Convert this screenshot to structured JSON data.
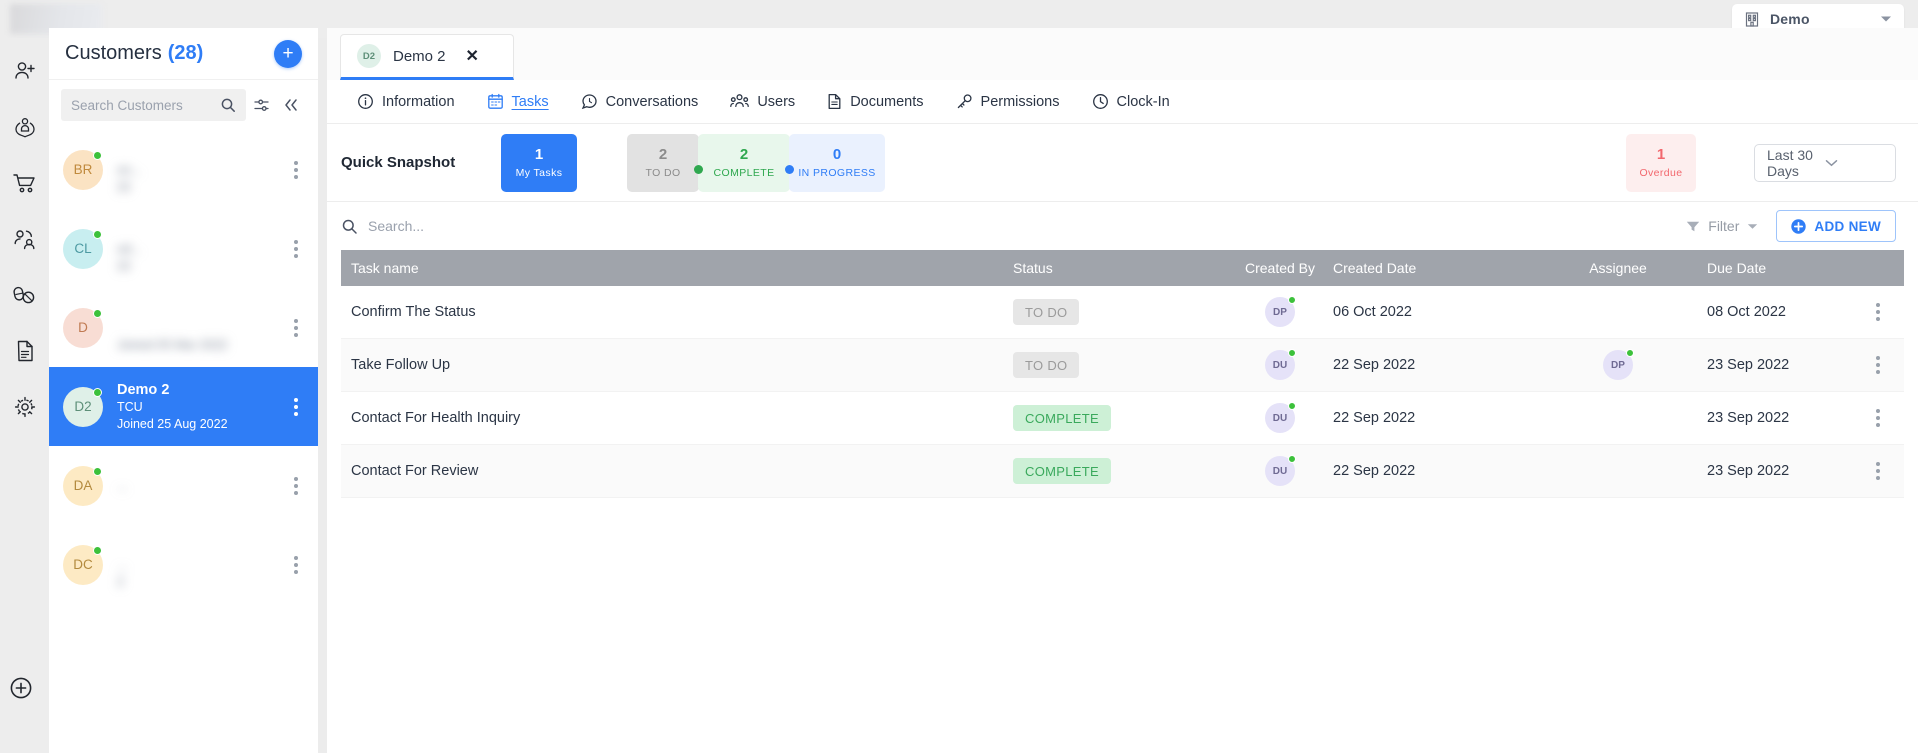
{
  "topbar": {
    "org_name": "Demo",
    "org_icon": "building-icon",
    "chevron_icon": "chevron-down-icon"
  },
  "rail": {
    "items": [
      {
        "icon": "add-user-icon",
        "name": "rail-item-add-user"
      },
      {
        "icon": "care-hands-icon",
        "name": "rail-item-care"
      },
      {
        "icon": "shopping-cart-icon",
        "name": "rail-item-orders"
      },
      {
        "icon": "users-group-icon",
        "name": "rail-item-users"
      },
      {
        "icon": "pills-icon",
        "name": "rail-item-medication"
      },
      {
        "icon": "document-icon",
        "name": "rail-item-documents"
      },
      {
        "icon": "gear-icon",
        "name": "rail-item-settings"
      }
    ],
    "bottom_icon": "circle-plus-icon"
  },
  "customers": {
    "title": "Customers",
    "count": "(28)",
    "add_button": "+",
    "search_placeholder": "Search Customers",
    "search_icon": "search-icon",
    "filter_icon": "sliders-icon",
    "collapse_icon": "double-chevron-left-icon",
    "rows": [
      {
        "initials": "BR",
        "avatar_color": "#fbe3c3",
        "text_color": "#c08a3d",
        "name": "",
        "sub": "on...",
        "joined": "22",
        "blurred": true,
        "selected": false
      },
      {
        "initials": "CL",
        "avatar_color": "#c8eef0",
        "text_color": "#4d9aa2",
        "name": "",
        "sub": "od...",
        "joined": "22",
        "blurred": true,
        "selected": false
      },
      {
        "initials": "D",
        "avatar_color": "#f8ddd4",
        "text_color": "#c07a52",
        "name": "",
        "sub": "",
        "joined": "Joined 05 Mar 2022",
        "blurred": true,
        "selected": false
      },
      {
        "initials": "D2",
        "avatar_color": "#dff0e8",
        "text_color": "#5d8f78",
        "name": "Demo 2",
        "sub": "TCU",
        "joined": "Joined 25 Aug 2022",
        "blurred": false,
        "selected": true
      },
      {
        "initials": "DA",
        "avatar_color": "#fdeac4",
        "text_color": "#b38a3e",
        "name": "",
        "sub": "...",
        "joined": "",
        "blurred": true,
        "selected": false
      },
      {
        "initials": "DC",
        "avatar_color": "#fdeac4",
        "text_color": "#b38a3e",
        "name": "",
        "sub": "...",
        "joined": "2",
        "blurred": true,
        "selected": false
      }
    ]
  },
  "doc_tab": {
    "initials": "D2",
    "label": "Demo 2",
    "close_icon": "close-icon"
  },
  "navtabs": [
    {
      "label": "Information",
      "icon": "info-circle-icon",
      "active": false
    },
    {
      "label": "Tasks",
      "icon": "task-list-icon",
      "active": true
    },
    {
      "label": "Conversations",
      "icon": "chat-bubble-icon",
      "active": false
    },
    {
      "label": "Users",
      "icon": "users-group-icon",
      "active": false
    },
    {
      "label": "Documents",
      "icon": "document-icon",
      "active": false
    },
    {
      "label": "Permissions",
      "icon": "key-icon",
      "active": false
    },
    {
      "label": "Clock-In",
      "icon": "clock-icon",
      "active": false
    }
  ],
  "snapshot": {
    "label": "Quick Snapshot",
    "my_tasks": {
      "value": "1",
      "caption": "My Tasks"
    },
    "todo": {
      "value": "2",
      "caption": "TO DO"
    },
    "complete": {
      "value": "2",
      "caption": "COMPLETE"
    },
    "in_progress": {
      "value": "0",
      "caption": "IN PROGRESS"
    },
    "overdue": {
      "value": "1",
      "caption": "Overdue"
    },
    "range": {
      "value": "Last 30 Days",
      "chevron_icon": "chevron-down-icon"
    }
  },
  "toolbar": {
    "search_placeholder": "Search...",
    "search_icon": "search-icon",
    "filter_label": "Filter",
    "filter_icon": "funnel-icon",
    "filter_chevron": "chevron-down-icon",
    "add_new_label": "ADD NEW",
    "add_new_icon": "circle-plus-icon"
  },
  "table": {
    "columns": [
      "Task name",
      "Status",
      "Created By",
      "Created Date",
      "Assignee",
      "Due Date"
    ],
    "rows": [
      {
        "task": "Confirm The Status",
        "status": "TO DO",
        "status_type": "todo",
        "created_by": "DP",
        "created_date": "06 Oct 2022",
        "assignee": "",
        "due_date": "08 Oct 2022"
      },
      {
        "task": "Take Follow Up",
        "status": "TO DO",
        "status_type": "todo",
        "created_by": "DU",
        "created_date": "22 Sep 2022",
        "assignee": "DP",
        "due_date": "23 Sep 2022"
      },
      {
        "task": "Contact For Health Inquiry",
        "status": "COMPLETE",
        "status_type": "complete",
        "created_by": "DU",
        "created_date": "22 Sep 2022",
        "assignee": "",
        "due_date": "23 Sep 2022"
      },
      {
        "task": "Contact For Review",
        "status": "COMPLETE",
        "status_type": "complete",
        "created_by": "DU",
        "created_date": "22 Sep 2022",
        "assignee": "",
        "due_date": "23 Sep 2022"
      }
    ]
  },
  "colors": {
    "accent_blue": "#2f7df6",
    "complete_green": "#3aa95c",
    "overdue_red": "#f2676d",
    "header_gray": "#a0a4ab",
    "online_green": "#3cc13b"
  }
}
